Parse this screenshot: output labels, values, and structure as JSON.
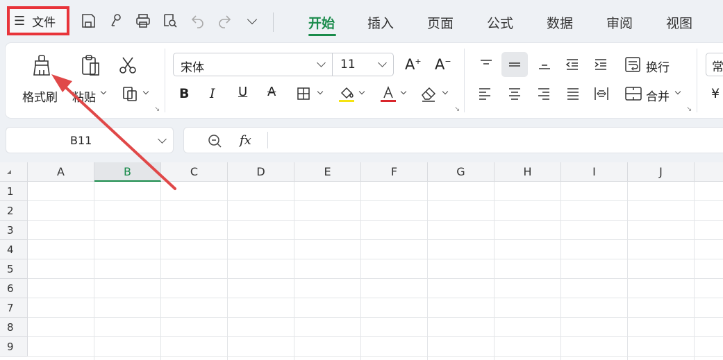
{
  "topbar": {
    "file_label": "文件",
    "tabs": [
      "开始",
      "插入",
      "页面",
      "公式",
      "数据",
      "审阅",
      "视图"
    ],
    "active_tab": "开始"
  },
  "ribbon": {
    "format_painter": "格式刷",
    "paste": "粘贴",
    "font_name": "宋体",
    "font_size": "11",
    "wrap_text": "换行",
    "merge": "合并",
    "number_format_partial": "常",
    "currency_partial": "¥"
  },
  "formula_bar": {
    "cell_ref": "B11",
    "fx": "fx"
  },
  "sheet": {
    "columns": [
      "A",
      "B",
      "C",
      "D",
      "E",
      "F",
      "G",
      "H",
      "I",
      "J"
    ],
    "selected_column": "B",
    "rows": [
      "1",
      "2",
      "3",
      "4",
      "5",
      "6",
      "7",
      "8",
      "9"
    ]
  },
  "colors": {
    "accent": "#1a8b4b",
    "highlight_box": "#e8343a",
    "annotation_arrow": "#e04848",
    "fill_color_bar": "#f5e312",
    "font_color_bar": "#d9262c"
  }
}
